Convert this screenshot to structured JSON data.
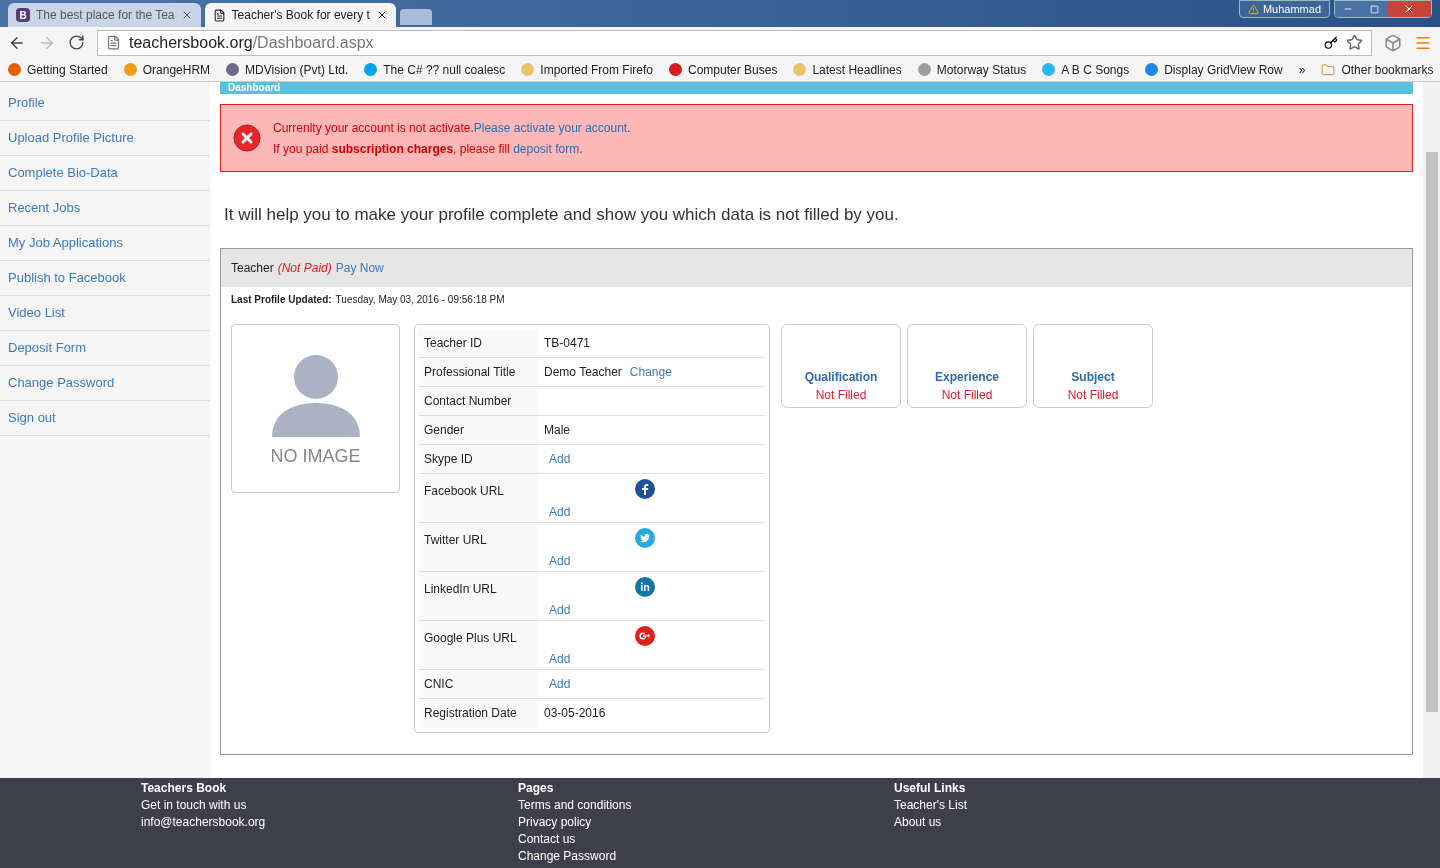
{
  "browser": {
    "tabs": [
      {
        "title": "The best place for the Tea",
        "selected": false,
        "icon": "B"
      },
      {
        "title": "Teacher's Book for every t",
        "selected": true
      }
    ],
    "profile": "Muhammad",
    "address": {
      "domain": "teachersbook.org",
      "path": "/Dashboard.aspx"
    },
    "bookmarks": [
      {
        "label": "Getting Started",
        "color": "#e66000"
      },
      {
        "label": "OrangeHRM",
        "color": "#f39c12"
      },
      {
        "label": "MDVision (Pvt) Ltd.",
        "color": "#6b6b8a"
      },
      {
        "label": "The C# ?? null coalesc",
        "color": "#00a4ef"
      },
      {
        "label": "Imported From Firefo",
        "color": "#e8c46a"
      },
      {
        "label": "Computer Buses",
        "color": "#d81b1b"
      },
      {
        "label": "Latest Headlines",
        "color": "#e8c46a"
      },
      {
        "label": "Motorway Status",
        "color": "#9e9e9e"
      },
      {
        "label": "A B C Songs",
        "color": "#29b6f6"
      },
      {
        "label": "Display GridView Row",
        "color": "#1e88e5"
      }
    ],
    "more": "»",
    "other": "Other bookmarks"
  },
  "sidebar": {
    "items": [
      {
        "label": "Profile"
      },
      {
        "label": "Upload Profile Picture"
      },
      {
        "label": "Complete Bio-Data"
      },
      {
        "label": "Recent Jobs"
      },
      {
        "label": "My Job Applications"
      },
      {
        "label": "Publish to Facebook"
      },
      {
        "label": "Video List"
      },
      {
        "label": "Deposit Form"
      },
      {
        "label": "Change Password"
      },
      {
        "label": "Sign out"
      }
    ]
  },
  "heading": "Dashboard",
  "alert": {
    "lines": [
      [
        {
          "kind": "text",
          "text": "Currenlty your account is not activate."
        },
        {
          "kind": "link",
          "text": "Please activate your account"
        },
        {
          "kind": "text",
          "text": "."
        }
      ],
      [
        {
          "kind": "text",
          "text": "If you paid **subscription charges**, please fill "
        },
        {
          "kind": "link",
          "text": "deposit form"
        },
        {
          "kind": "text",
          "text": "."
        }
      ]
    ]
  },
  "intro": "It will help you to make your profile complete and show you which data is not filled by you.",
  "panel": {
    "role": "Teacher",
    "status": "(Not Paid)",
    "action": "Pay Now",
    "updated_label": "Last Profile Updated:",
    "updated_value": "Tuesday, May 03, 2016 - 09:56:18 PM",
    "photo_text": "NO IMAGE",
    "fields": [
      {
        "kind": "text",
        "label": "Teacher ID",
        "value": "TB-0471"
      },
      {
        "kind": "text",
        "label": "Professional Title",
        "value": "Demo Teacher",
        "action": "Change"
      },
      {
        "kind": "text",
        "label": "Contact Number"
      },
      {
        "kind": "text",
        "label": "Gender",
        "value": "Male"
      },
      {
        "kind": "action",
        "label": "Skype ID",
        "action": "Add"
      },
      {
        "kind": "facebook",
        "label": "Facebook URL",
        "action": "Add"
      },
      {
        "kind": "twitter",
        "label": "Twitter URL",
        "action": "Add"
      },
      {
        "kind": "linkedin",
        "label": "LinkedIn URL",
        "action": "Add"
      },
      {
        "kind": "googleplus",
        "label": "Google Plus URL",
        "action": "Add"
      },
      {
        "kind": "action",
        "label": "CNIC",
        "action": "Add"
      },
      {
        "kind": "text",
        "label": "Registration Date",
        "value": "03-05-2016"
      }
    ],
    "cards": [
      {
        "title": "Qualification",
        "status": "Not Filled"
      },
      {
        "title": "Experience",
        "status": "Not Filled"
      },
      {
        "title": "Subject",
        "status": "Not Filled"
      }
    ]
  },
  "footer": [
    {
      "title": "Teachers Book",
      "links": [
        "Get in touch with us",
        "info@teachersbook.org"
      ]
    },
    {
      "title": "Pages",
      "links": [
        "Terms and conditions",
        "Privacy policy",
        "Contact us",
        "Change Password"
      ]
    },
    {
      "title": "Useful Links",
      "links": [
        "Teacher's List",
        "About us"
      ]
    }
  ]
}
